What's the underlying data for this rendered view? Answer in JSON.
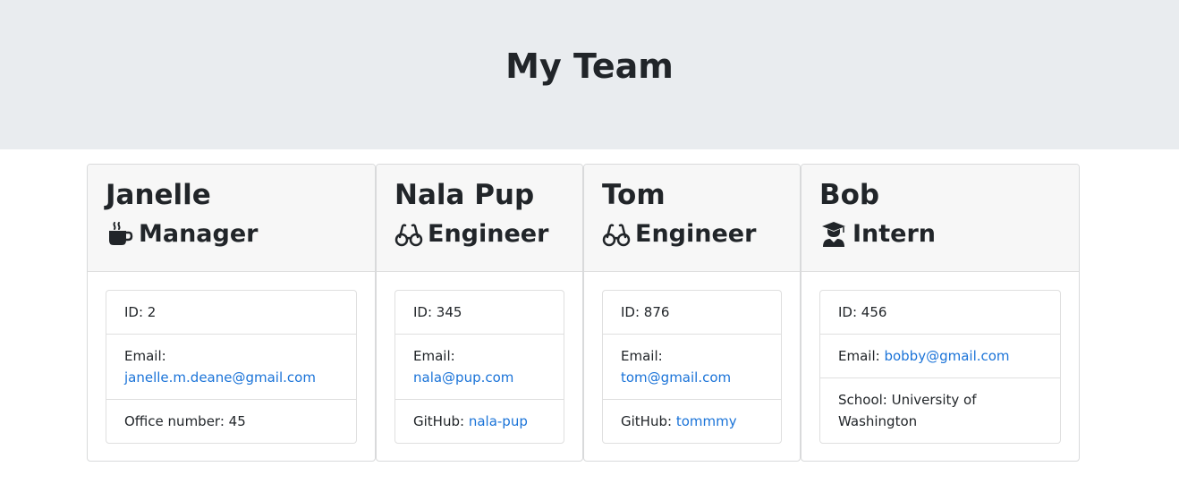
{
  "page": {
    "title": "My Team"
  },
  "colors": {
    "header_bg": "#e9ecef",
    "card_header_bg": "#f7f7f7",
    "link": "#1a73d8",
    "text": "#212529"
  },
  "employees": [
    {
      "name": "Janelle",
      "role": "Manager",
      "role_icon": "mug-hot-icon",
      "id_label": "ID: 2",
      "email_label": "Email:",
      "email": "janelle.m.deane@gmail.com",
      "extra_text": "Office number: 45"
    },
    {
      "name": "Nala Pup",
      "role": "Engineer",
      "role_icon": "glasses-icon",
      "id_label": "ID: 345",
      "email_label": "Email:",
      "email": "nala@pup.com",
      "extra_label": "GitHub:",
      "extra_link": "nala-pup"
    },
    {
      "name": "Tom",
      "role": "Engineer",
      "role_icon": "glasses-icon",
      "id_label": "ID: 876",
      "email_label": "Email:",
      "email": "tom@gmail.com",
      "extra_label": "GitHub:",
      "extra_link": "tommmy"
    },
    {
      "name": "Bob",
      "role": "Intern",
      "role_icon": "graduate-icon",
      "id_label": "ID: 456",
      "email_label": "Email:",
      "email": "bobby@gmail.com",
      "extra_text": "School: University of Washington"
    }
  ]
}
